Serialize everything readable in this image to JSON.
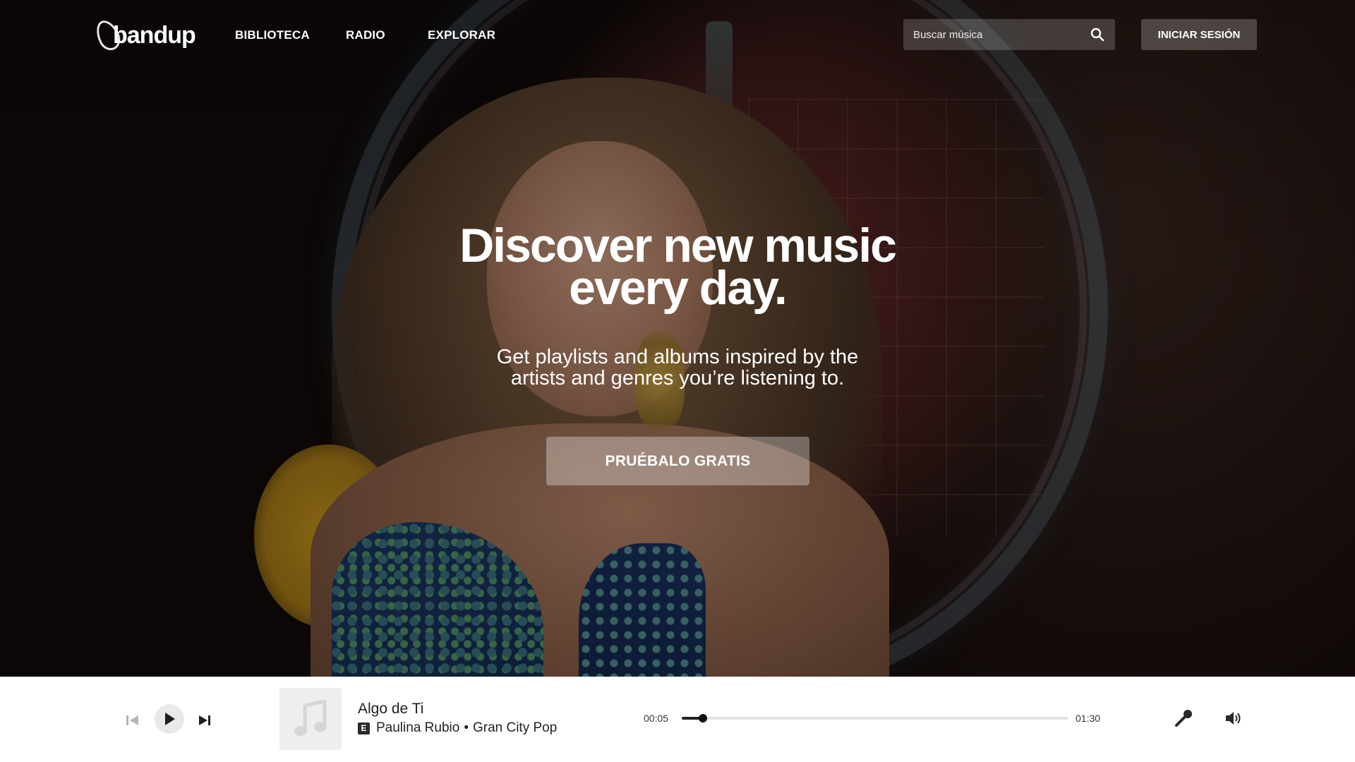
{
  "brand": {
    "logo_text": "bandup"
  },
  "nav": {
    "links": [
      "BIBLIOTECA",
      "RADIO",
      "EXPLORAR"
    ]
  },
  "search": {
    "placeholder": "Buscar música"
  },
  "auth": {
    "login_label": "INICIAR SESIÓN"
  },
  "hero": {
    "title_line1": "Discover new music",
    "title_line2": "every day.",
    "subtitle_line1": "Get playlists and albums inspired by the",
    "subtitle_line2": "artists and genres you’re listening to.",
    "cta_label": "PRUÉBALO GRATIS"
  },
  "player": {
    "track_title": "Algo de Ti",
    "explicit_badge": "E",
    "artist": "Paulina Rubio",
    "separator": "•",
    "album": "Gran City Pop",
    "current_time": "00:05",
    "total_time": "01:30",
    "progress_fraction": 0.0556,
    "icons": [
      "previous-icon",
      "play-icon",
      "next-icon",
      "music-note-icon",
      "microphone-icon",
      "volume-icon"
    ]
  },
  "colors": {
    "player_bg": "#ffffff",
    "accent_dark": "#222222",
    "progress_track": "#e4e4e4"
  }
}
